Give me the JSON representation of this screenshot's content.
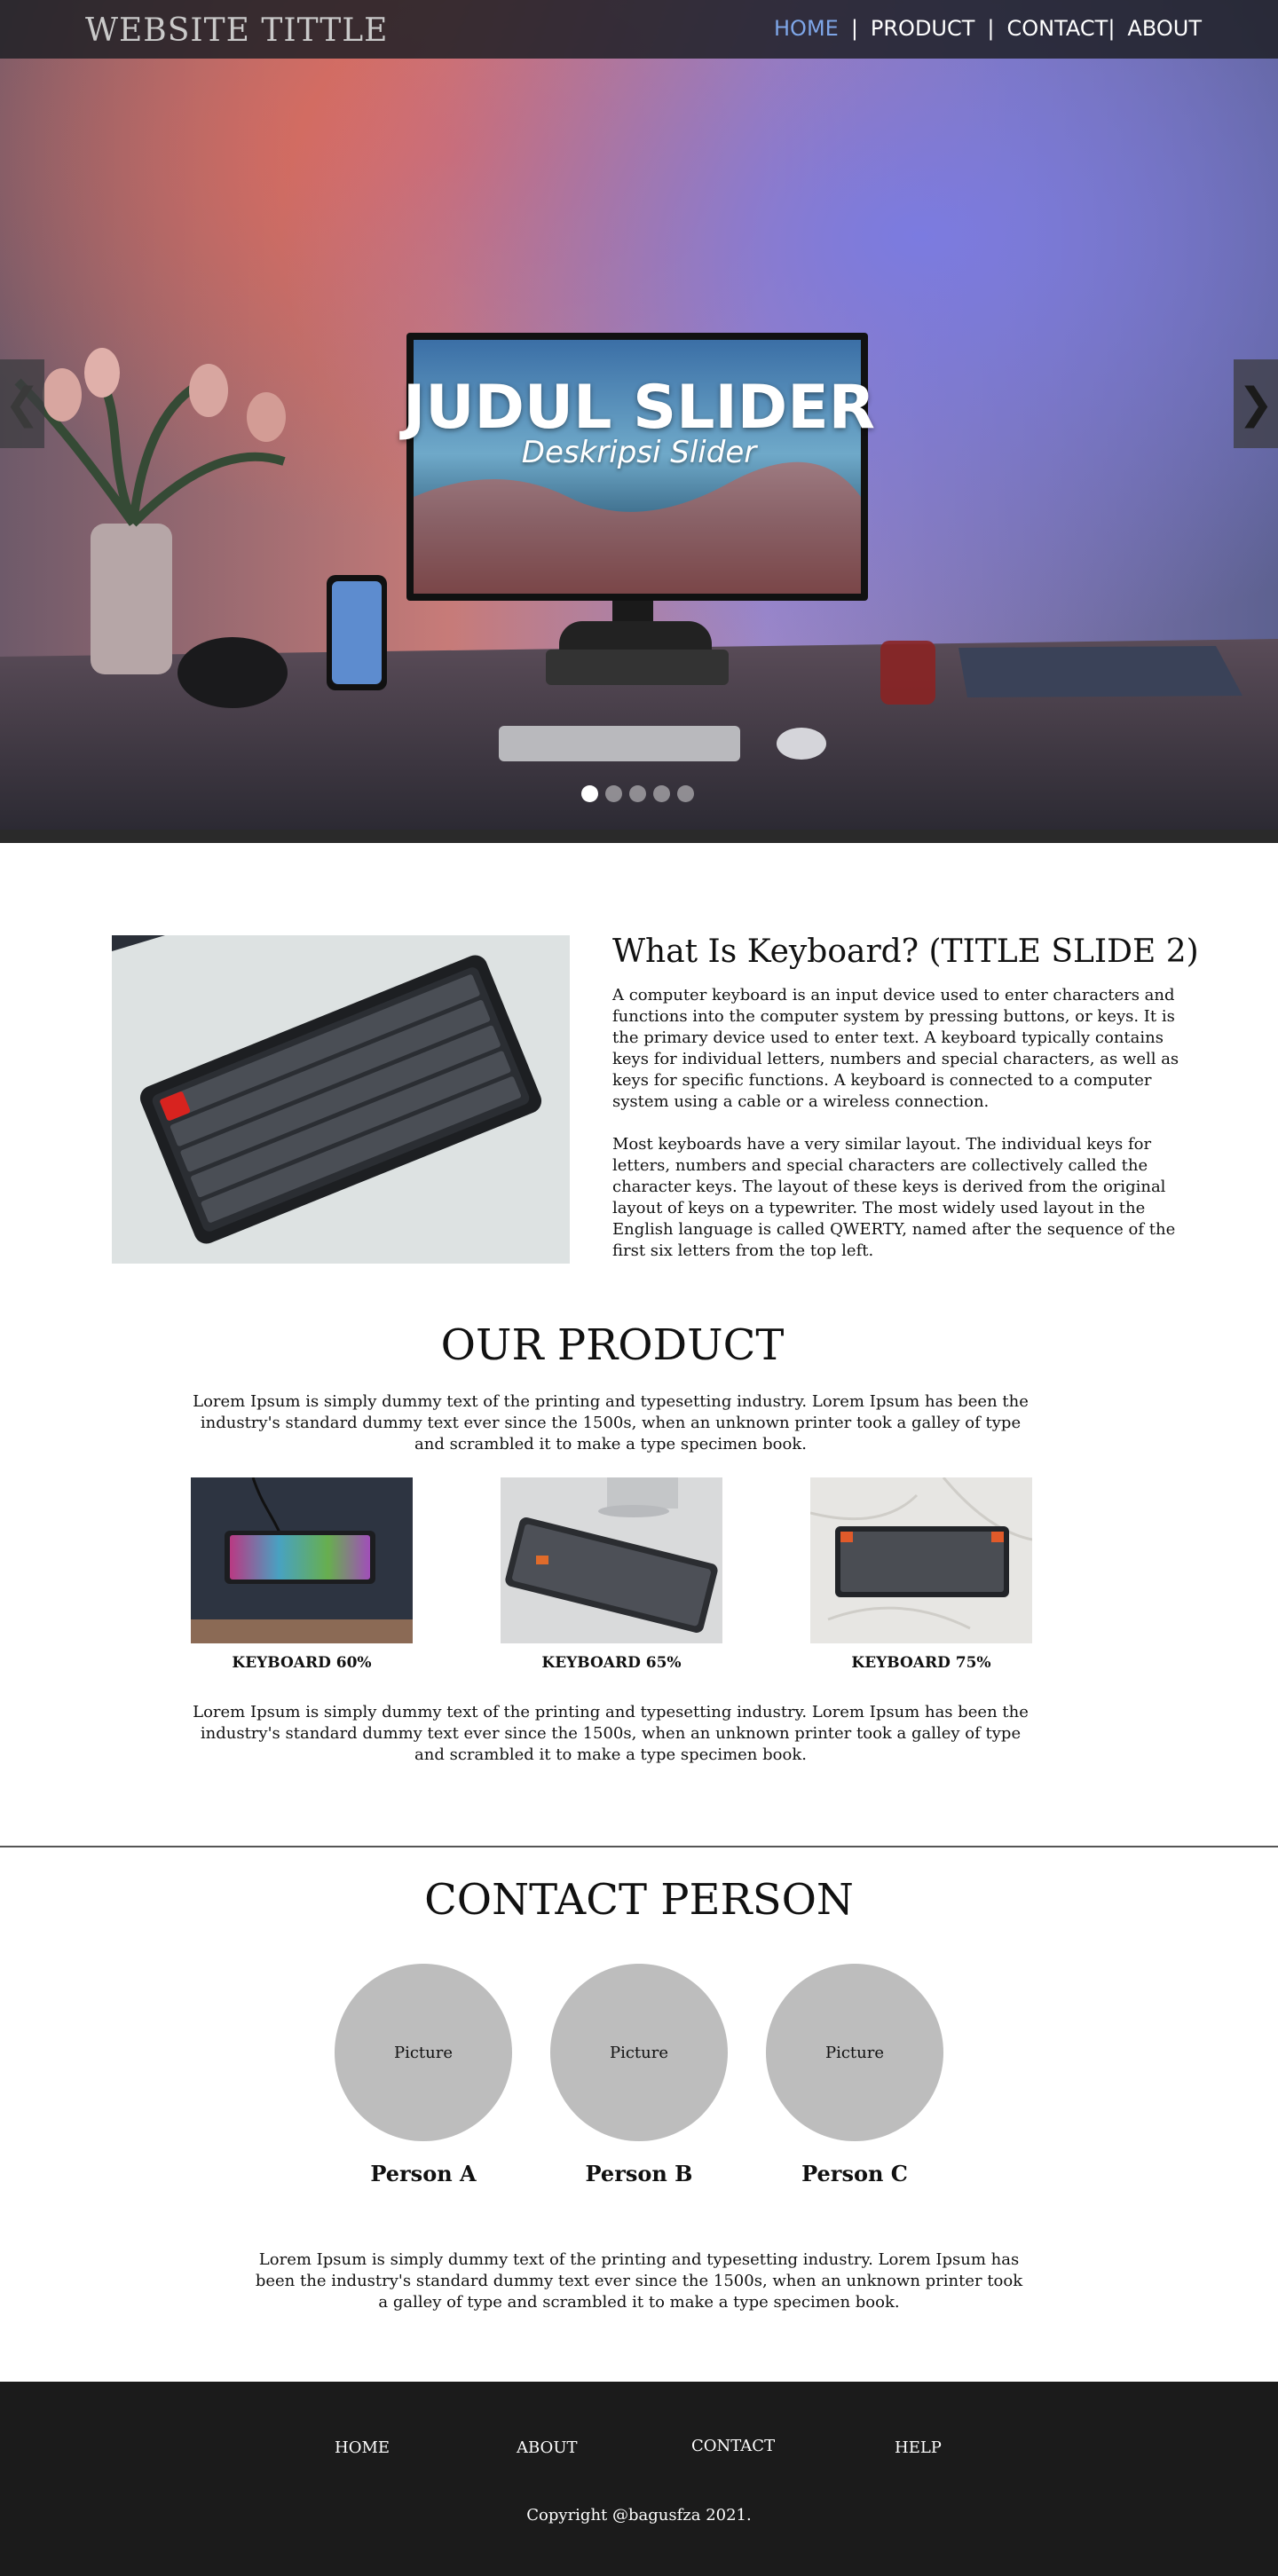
{
  "header": {
    "site_title": "WEBSITE TITTLE",
    "nav": {
      "home": "HOME",
      "product": "PRODUCT",
      "contact": "CONTACT",
      "about": "ABOUT",
      "separator": "|"
    }
  },
  "slider": {
    "title": "JUDUL SLIDER",
    "description": "Deskripsi Slider",
    "active_slide": 1,
    "slide_count": 5,
    "left_arrow_icon": "chevron-left-icon",
    "right_arrow_icon": "chevron-right-icon",
    "right_arrow_glyph": "❯",
    "left_arrow_glyph": "❮"
  },
  "about": {
    "title": "What Is Keyboard? (TITLE SLIDE 2)",
    "paragraph_1": "A computer keyboard is an input device used to enter characters and functions into the computer system by pressing buttons, or keys. It is the primary device used to enter text. A keyboard typically contains keys for individual letters, numbers and special characters, as well as keys for specific functions. A keyboard is connected to a computer system using a cable or a wireless connection.",
    "paragraph_2": "Most keyboards have a very similar layout. The individual keys for letters, numbers and special characters are collectively called the character keys. The layout of these keys is derived from the original layout of keys on a typewriter. The most widely used layout in the English language is called QWERTY, named after the sequence of the first six letters from the top left."
  },
  "product": {
    "heading": "OUR PRODUCT",
    "intro": "Lorem Ipsum is simply dummy text of the printing and typesetting industry. Lorem Ipsum has been the industry's standard dummy text ever since the 1500s, when an unknown printer took a galley of type and scrambled it to make a type specimen book.",
    "items": [
      {
        "name": "KEYBOARD 60%"
      },
      {
        "name": "KEYBOARD 65%"
      },
      {
        "name": "KEYBOARD 75%"
      }
    ],
    "outro": "Lorem Ipsum is simply dummy text of the printing and typesetting industry. Lorem Ipsum has been the industry's standard dummy text ever since the 1500s, when an unknown printer took a galley of type and scrambled it to make a type specimen book."
  },
  "contact": {
    "heading": "CONTACT PERSON",
    "people": [
      {
        "picture_label": "Picture",
        "name": "Person A"
      },
      {
        "picture_label": "Picture",
        "name": "Person B"
      },
      {
        "picture_label": "Picture",
        "name": "Person C"
      }
    ],
    "text": "Lorem Ipsum is simply dummy text of the printing and typesetting industry. Lorem Ipsum has been the industry's standard dummy text ever since the 1500s, when an unknown printer took a galley of type and scrambled it to make a type specimen book."
  },
  "footer": {
    "links": {
      "home": "HOME",
      "about": "ABOUT",
      "contact": "CONTACT",
      "help": "HELP"
    },
    "copyright": "Copyright @bagusfza 2021."
  },
  "colors": {
    "nav_active": "#7ea6e8",
    "footer_bg": "#1b1b1b",
    "avatar_bg": "#bdbdbd"
  }
}
